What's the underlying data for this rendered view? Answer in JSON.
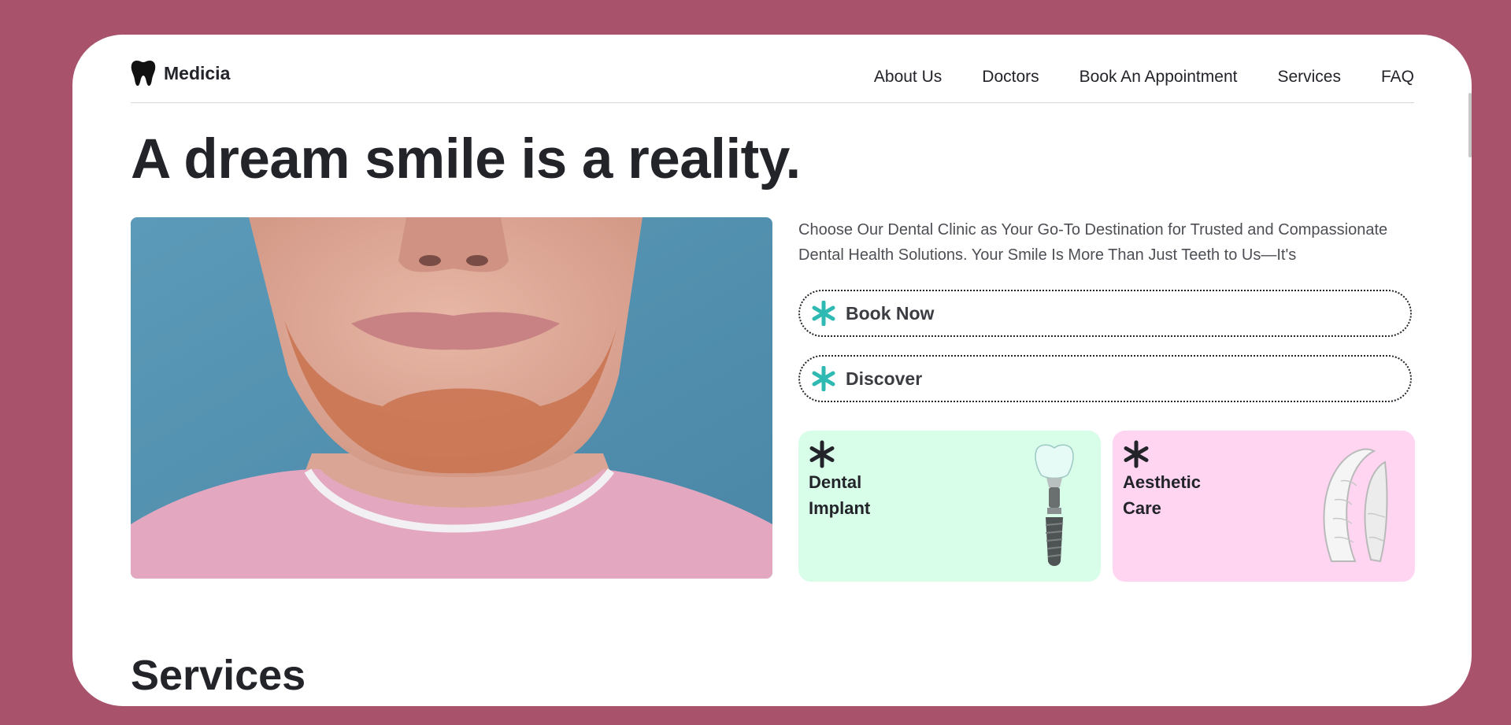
{
  "brand": {
    "name": "Medicia",
    "logo_icon": "tooth-icon"
  },
  "nav": {
    "links": [
      "About Us",
      "Doctors",
      "Book An Appointment",
      "Services",
      "FAQ"
    ]
  },
  "hero": {
    "title": "A dream smile is a reality.",
    "description": "Choose Our Dental Clinic as Your Go-To Destination for Trusted and Compassionate Dental Health Solutions. Your Smile Is More Than Just Teeth to Us—It's",
    "buttons": [
      {
        "label": "Book Now",
        "icon": "asterisk-icon"
      },
      {
        "label": "Discover",
        "icon": "asterisk-icon"
      }
    ],
    "tiles": [
      {
        "label": "Dental Implant",
        "icon": "asterisk-icon",
        "image": "dental-implant-image",
        "bg": "#d8fde9"
      },
      {
        "label": "Aesthetic Care",
        "icon": "asterisk-icon",
        "image": "clear-aligner-image",
        "bg": "#ffd5f1"
      }
    ]
  },
  "services": {
    "title": "Services"
  },
  "colors": {
    "page_bg": "#a8526c",
    "accent": "#2fb9b3",
    "text": "#22242a"
  }
}
